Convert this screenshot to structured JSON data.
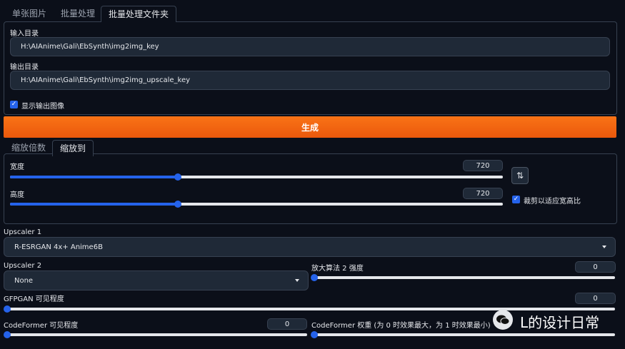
{
  "tabs_top": [
    "单张图片",
    "批量处理",
    "批量处理文件夹"
  ],
  "input_dir": {
    "label": "输入目录",
    "value": "H:\\AIAnime\\Gali\\EbSynth\\img2img_key"
  },
  "output_dir": {
    "label": "输出目录",
    "value": "H:\\AIAnime\\Gali\\EbSynth\\img2img_upscale_key"
  },
  "show_output": {
    "label": "显示输出图像",
    "checked": true
  },
  "generate_label": "生成",
  "tabs_scale": [
    "缩放倍数",
    "缩放到"
  ],
  "width": {
    "label": "宽度",
    "value": "720",
    "fraction": 0.34
  },
  "height": {
    "label": "高度",
    "value": "720",
    "fraction": 0.34
  },
  "swap_icon": "swap-vertical-icon",
  "crop": {
    "label": "裁剪以适应宽高比",
    "checked": true
  },
  "upscaler1": {
    "label": "Upscaler 1",
    "value": "R-ESRGAN 4x+ Anime6B"
  },
  "upscaler2": {
    "label": "Upscaler 2",
    "value": "None"
  },
  "upscaler2_strength": {
    "label": "放大算法 2 强度",
    "value": "0",
    "fraction": 0
  },
  "gfpgan": {
    "label": "GFPGAN 可见程度",
    "value": "0",
    "fraction": 0
  },
  "codeformer": {
    "label": "CodeFormer 可见程度",
    "value": "0",
    "fraction": 0
  },
  "codeformer_weight": {
    "label": "CodeFormer 权重 (为 0 时效果最大，为 1 时效果最小)"
  },
  "watermark": {
    "text": "L的设计日常"
  },
  "colors": {
    "accent": "#2563eb",
    "generate": "#f97316",
    "bg": "#0b0f19",
    "field": "#1f2937"
  }
}
